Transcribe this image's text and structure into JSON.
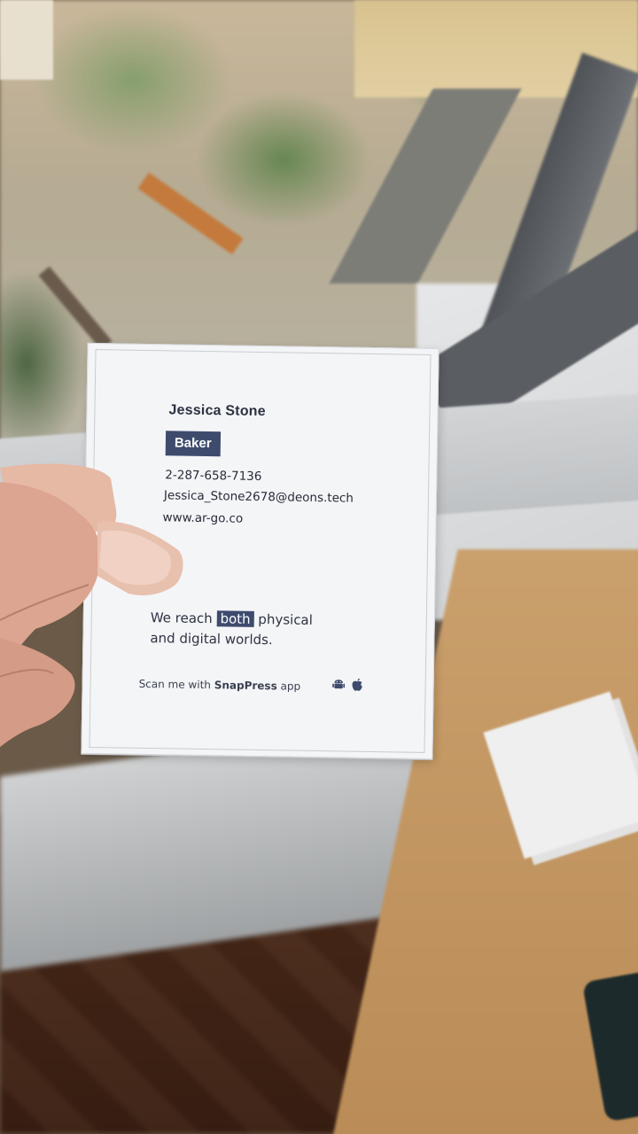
{
  "card": {
    "name": "Jessica Stone",
    "title": "Baker",
    "phone": "2-287-658-7136",
    "email": "Jessica_Stone2678@deons.tech",
    "website": "www.ar-go.co",
    "tagline": {
      "before": "We reach ",
      "highlight": "both",
      "after_line1": " physical",
      "line2": "and digital worlds."
    },
    "scan": {
      "prefix": "Scan me with ",
      "app_name": "SnapPress",
      "suffix": " app"
    },
    "icons": [
      "android-icon",
      "apple-icon"
    ],
    "accent_color": "#3e4b6d"
  }
}
